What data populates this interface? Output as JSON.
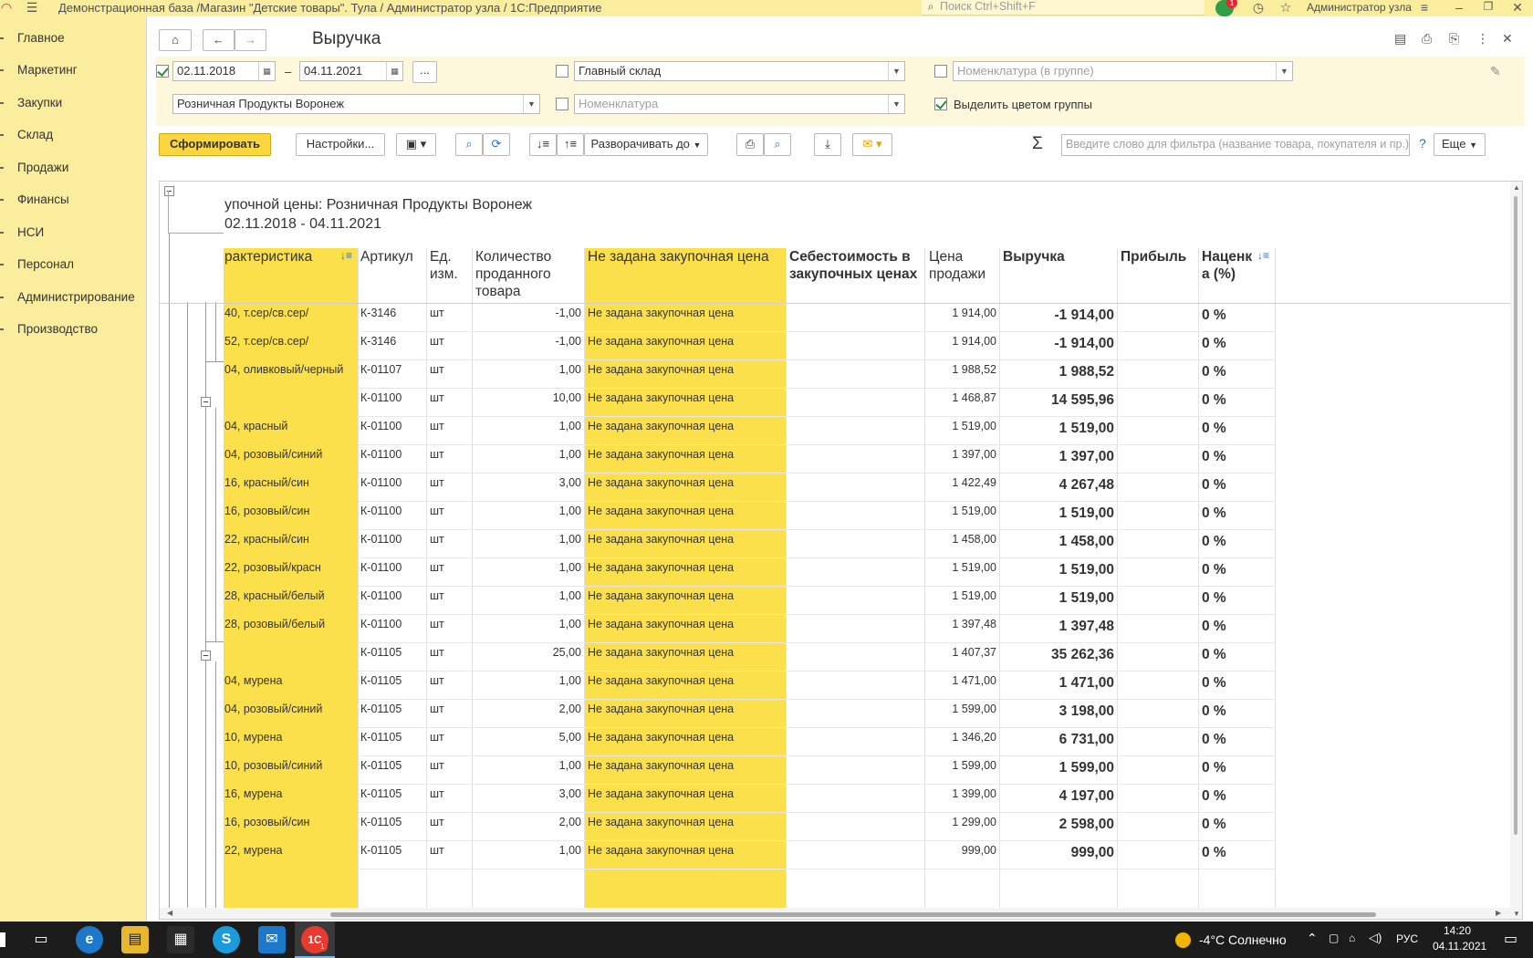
{
  "window": {
    "title": "Демонстрационная база /Магазин \"Детские товары\". Тула / Администратор узла / 1С:Предприятие",
    "search_placeholder": "Поиск Ctrl+Shift+F",
    "user": "Администратор узла",
    "notification_count": "1"
  },
  "sidebar": {
    "items": [
      {
        "label": "Главное"
      },
      {
        "label": "Маркетинг"
      },
      {
        "label": "Закупки"
      },
      {
        "label": "Склад"
      },
      {
        "label": "Продажи"
      },
      {
        "label": "Финансы"
      },
      {
        "label": "НСИ"
      },
      {
        "label": "Персонал"
      },
      {
        "label": "Администрирование"
      },
      {
        "label": "Производство"
      }
    ]
  },
  "page": {
    "title": "Выручка"
  },
  "filters": {
    "date_from": "02.11.2018",
    "date_sep": "–",
    "date_to": "04.11.2021",
    "more_btn": "...",
    "warehouse": "Главный склад",
    "nomenclature_group_placeholder": "Номенклатура (в группе)",
    "price_type": "Розничная Продукты Воронеж",
    "nomenclature_placeholder": "Номенклатура",
    "highlight_label": "Выделить цветом группы"
  },
  "toolbar": {
    "generate": "Сформировать",
    "settings": "Настройки...",
    "expand_to": "Разворачивать до",
    "filter_placeholder": "Введите слово для фильтра (название товара, покупателя и пр.)",
    "help": "?",
    "more": "Еще",
    "sigma": "Σ"
  },
  "report": {
    "header_line1": "упочной цены: Розничная Продукты Воронеж",
    "header_line2": "02.11.2018 - 04.11.2021",
    "columns": {
      "characteristic": "рактеристика",
      "article": "Артикул",
      "unit": "Ед. изм.",
      "qty": "Количество проданного товара",
      "no_price": "Не задана закупочная цена",
      "cost": "Себестоимость в закупочных ценах",
      "price": "Цена продажи",
      "revenue": "Выручка",
      "profit": "Прибыль",
      "markup": "Наценк а (%)"
    },
    "rows": [
      {
        "char": "40, т.сер/св.сер/",
        "art": "К-3146",
        "unit": "шт",
        "qty": "-1,00",
        "np": "Не задана закупочная цена",
        "price": "1 914,00",
        "rev": "-1 914,00",
        "markup": "0 %"
      },
      {
        "char": "52, т.сер/св.сер/",
        "art": "К-3146",
        "unit": "шт",
        "qty": "-1,00",
        "np": "Не задана закупочная цена",
        "price": "1 914,00",
        "rev": "-1 914,00",
        "markup": "0 %"
      },
      {
        "char": "04, оливковый/черный",
        "art": "К-01107",
        "unit": "шт",
        "qty": "1,00",
        "np": "Не задана закупочная цена",
        "price": "1 988,52",
        "rev": "1 988,52",
        "markup": "0 %"
      },
      {
        "char": "",
        "art": "К-01100",
        "unit": "шт",
        "qty": "10,00",
        "np": "Не задана закупочная цена",
        "price": "1 468,87",
        "rev": "14 595,96",
        "markup": "0 %"
      },
      {
        "char": "04, красный",
        "art": "К-01100",
        "unit": "шт",
        "qty": "1,00",
        "np": "Не задана закупочная цена",
        "price": "1 519,00",
        "rev": "1 519,00",
        "markup": "0 %"
      },
      {
        "char": "04, розовый/синий",
        "art": "К-01100",
        "unit": "шт",
        "qty": "1,00",
        "np": "Не задана закупочная цена",
        "price": "1 397,00",
        "rev": "1 397,00",
        "markup": "0 %"
      },
      {
        "char": "16, красный/син",
        "art": "К-01100",
        "unit": "шт",
        "qty": "3,00",
        "np": "Не задана закупочная цена",
        "price": "1 422,49",
        "rev": "4 267,48",
        "markup": "0 %"
      },
      {
        "char": "16, розовый/син",
        "art": "К-01100",
        "unit": "шт",
        "qty": "1,00",
        "np": "Не задана закупочная цена",
        "price": "1 519,00",
        "rev": "1 519,00",
        "markup": "0 %"
      },
      {
        "char": "22, красный/син",
        "art": "К-01100",
        "unit": "шт",
        "qty": "1,00",
        "np": "Не задана закупочная цена",
        "price": "1 458,00",
        "rev": "1 458,00",
        "markup": "0 %"
      },
      {
        "char": "22, розовый/красн",
        "art": "К-01100",
        "unit": "шт",
        "qty": "1,00",
        "np": "Не задана закупочная цена",
        "price": "1 519,00",
        "rev": "1 519,00",
        "markup": "0 %"
      },
      {
        "char": "28, красный/белый",
        "art": "К-01100",
        "unit": "шт",
        "qty": "1,00",
        "np": "Не задана закупочная цена",
        "price": "1 519,00",
        "rev": "1 519,00",
        "markup": "0 %"
      },
      {
        "char": "28, розовый/белый",
        "art": "К-01100",
        "unit": "шт",
        "qty": "1,00",
        "np": "Не задана закупочная цена",
        "price": "1 397,48",
        "rev": "1 397,48",
        "markup": "0 %"
      },
      {
        "char": "",
        "art": "К-01105",
        "unit": "шт",
        "qty": "25,00",
        "np": "Не задана закупочная цена",
        "price": "1 407,37",
        "rev": "35 262,36",
        "markup": "0 %"
      },
      {
        "char": "04, мурена",
        "art": "К-01105",
        "unit": "шт",
        "qty": "1,00",
        "np": "Не задана закупочная цена",
        "price": "1 471,00",
        "rev": "1 471,00",
        "markup": "0 %"
      },
      {
        "char": "04, розовый/синий",
        "art": "К-01105",
        "unit": "шт",
        "qty": "2,00",
        "np": "Не задана закупочная цена",
        "price": "1 599,00",
        "rev": "3 198,00",
        "markup": "0 %"
      },
      {
        "char": "10, мурена",
        "art": "К-01105",
        "unit": "шт",
        "qty": "5,00",
        "np": "Не задана закупочная цена",
        "price": "1 346,20",
        "rev": "6 731,00",
        "markup": "0 %"
      },
      {
        "char": "10, розовый/синий",
        "art": "К-01105",
        "unit": "шт",
        "qty": "1,00",
        "np": "Не задана закупочная цена",
        "price": "1 599,00",
        "rev": "1 599,00",
        "markup": "0 %"
      },
      {
        "char": "16, мурена",
        "art": "К-01105",
        "unit": "шт",
        "qty": "3,00",
        "np": "Не задана закупочная цена",
        "price": "1 399,00",
        "rev": "4 197,00",
        "markup": "0 %"
      },
      {
        "char": "16, розовый/син",
        "art": "К-01105",
        "unit": "шт",
        "qty": "2,00",
        "np": "Не задана закупочная цена",
        "price": "1 299,00",
        "rev": "2 598,00",
        "markup": "0 %"
      },
      {
        "char": "22, мурена",
        "art": "К-01105",
        "unit": "шт",
        "qty": "1,00",
        "np": "Не задана закупочная цена",
        "price": "999,00",
        "rev": "999,00",
        "markup": "0 %"
      }
    ]
  },
  "taskbar": {
    "weather": "-4°C  Солнечно",
    "lang": "РУС",
    "time": "14:20",
    "date": "04.11.2021",
    "badge": "1"
  },
  "colors": {
    "accent_yellow": "#fbe04c",
    "chrome_yellow": "#fbed9e",
    "generate_button": "#fbd63f"
  }
}
